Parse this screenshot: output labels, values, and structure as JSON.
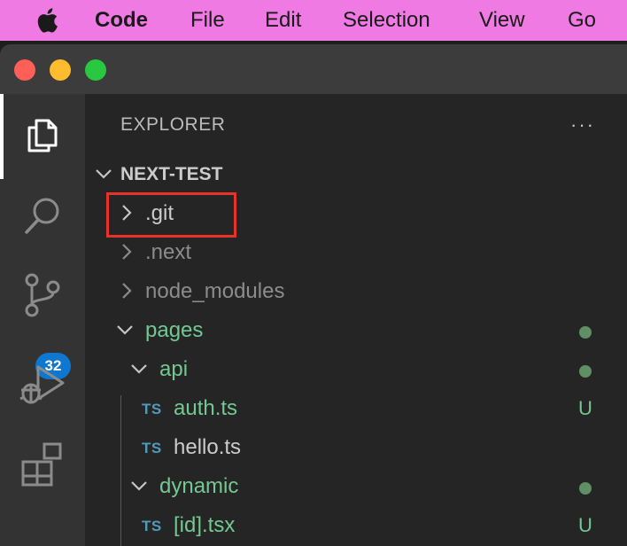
{
  "menubar": {
    "app_name": "Code",
    "items": [
      "File",
      "Edit",
      "Selection",
      "View",
      "Go"
    ]
  },
  "activity_bar": {
    "items": [
      "explorer-icon",
      "search-icon",
      "source-control-icon",
      "run-debug-icon",
      "extensions-icon"
    ],
    "source_control_badge": "32"
  },
  "sidebar": {
    "title": "EXPLORER",
    "more_actions": "···",
    "root_folder": "NEXT-TEST",
    "tree": [
      {
        "name": ".git",
        "kind": "folder",
        "expanded": false,
        "status": ""
      },
      {
        "name": ".next",
        "kind": "folder",
        "expanded": false,
        "status": ""
      },
      {
        "name": "node_modules",
        "kind": "folder",
        "expanded": false,
        "status": ""
      },
      {
        "name": "pages",
        "kind": "folder",
        "expanded": true,
        "status": "dot"
      },
      {
        "name": "api",
        "kind": "folder",
        "expanded": true,
        "status": "dot"
      },
      {
        "name": "auth.ts",
        "kind": "file",
        "icon": "TS",
        "status": "U"
      },
      {
        "name": "hello.ts",
        "kind": "file",
        "icon": "TS",
        "status": ""
      },
      {
        "name": "dynamic",
        "kind": "folder",
        "expanded": true,
        "status": "dot"
      },
      {
        "name": "[id].tsx",
        "kind": "file",
        "icon": "TS",
        "status": "U"
      }
    ]
  },
  "colors": {
    "menubar_bg": "#f07ae3",
    "modified_green": "#73c991",
    "ignored_gray": "#8c8c8c",
    "ts_blue": "#519aba",
    "highlight_red": "#e8322c",
    "badge_blue": "#0e78d0"
  }
}
